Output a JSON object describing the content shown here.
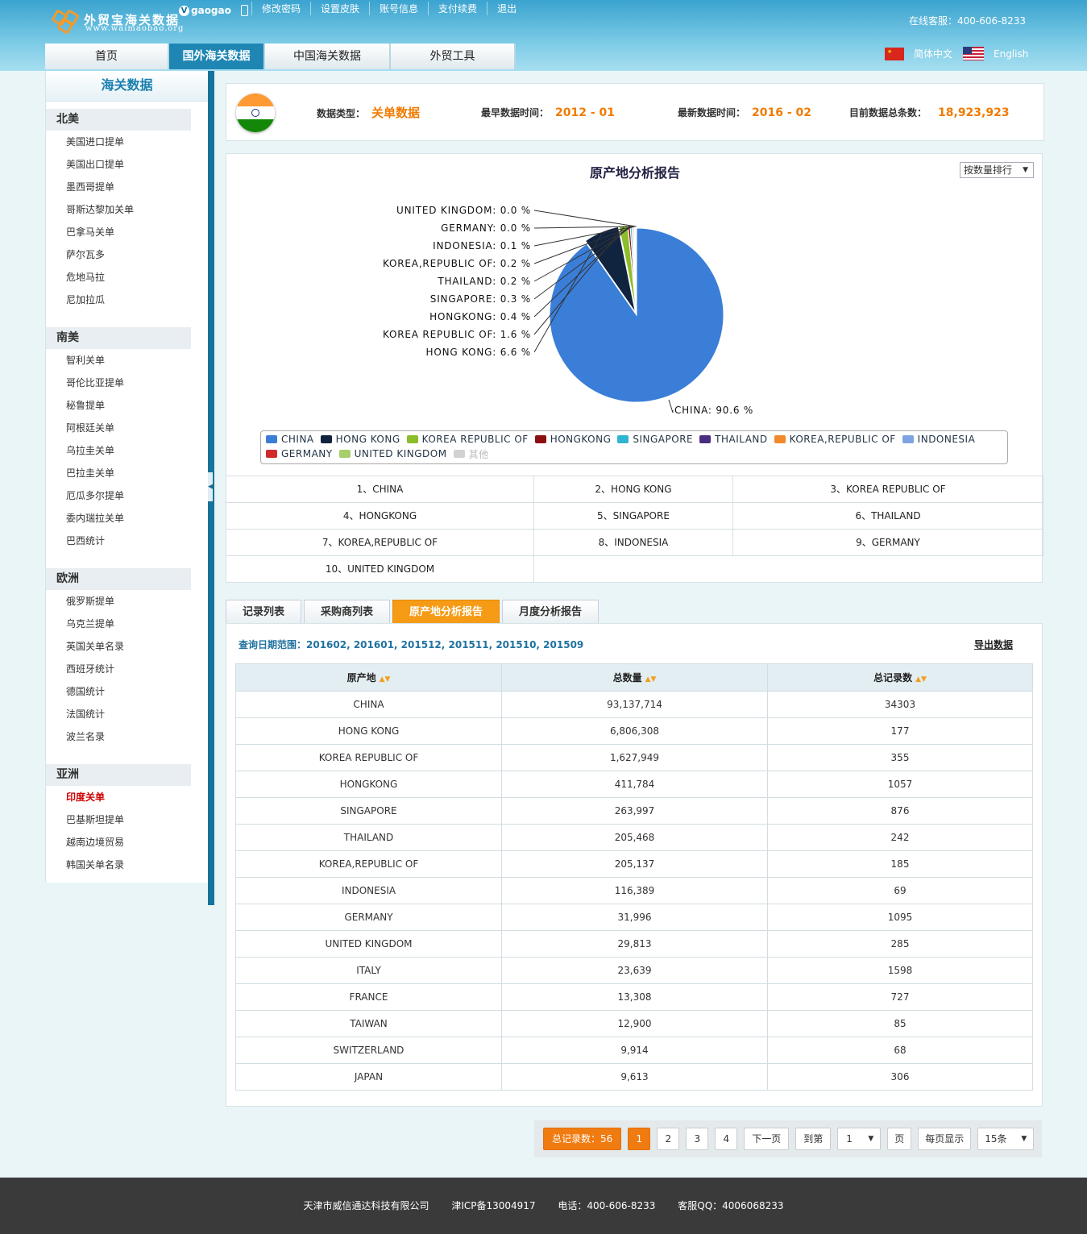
{
  "header": {
    "logo_title": "外贸宝海关数据",
    "logo_url": "www.waimaobao.org",
    "username": "gaogao",
    "links": [
      "修改密码",
      "设置皮肤",
      "账号信息",
      "支付续费",
      "退出"
    ],
    "service": "在线客服：400-606-8233",
    "nav": [
      "首页",
      "国外海关数据",
      "中国海关数据",
      "外贸工具"
    ],
    "lang_cn": "简体中文",
    "lang_en": "English"
  },
  "sidebar": {
    "title": "海关数据",
    "groups": [
      {
        "name": "北美",
        "items": [
          "美国进口提单",
          "美国出口提单",
          "墨西哥提单",
          "哥斯达黎加关单",
          "巴拿马关单",
          "萨尔瓦多",
          "危地马拉",
          "尼加拉瓜"
        ]
      },
      {
        "name": "南美",
        "items": [
          "智利关单",
          "哥伦比亚提单",
          "秘鲁提单",
          "阿根廷关单",
          "乌拉圭关单",
          "巴拉圭关单",
          "厄瓜多尔提单",
          "委内瑞拉关单",
          "巴西统计"
        ]
      },
      {
        "name": "欧洲",
        "items": [
          "俄罗斯提单",
          "乌克兰提单",
          "英国关单名录",
          "西班牙统计",
          "德国统计",
          "法国统计",
          "波兰名录"
        ]
      },
      {
        "name": "亚洲",
        "items": [
          "印度关单",
          "巴基斯坦提单",
          "越南边境贸易",
          "韩国关单名录"
        ]
      }
    ]
  },
  "info": {
    "type_label": "数据类型：",
    "type_value": "关单数据",
    "earliest_label": "最早数据时间：",
    "earliest_value": "2012 - 01",
    "latest_label": "最新数据时间：",
    "latest_value": "2016 - 02",
    "total_label": "目前数据总条数：",
    "total_value": "18,923,923"
  },
  "chart_data": {
    "type": "pie",
    "title": "原产地分析报告",
    "sort_select": "按数量排行",
    "slices": [
      {
        "label": "CHINA",
        "value": 90.6,
        "color": "#3a7ed8"
      },
      {
        "label": "HONG KONG",
        "value": 6.6,
        "color": "#10233f"
      },
      {
        "label": "KOREA REPUBLIC OF",
        "value": 1.6,
        "color": "#8cbd2a"
      },
      {
        "label": "HONGKONG",
        "value": 0.4,
        "color": "#8b0f12"
      },
      {
        "label": "SINGAPORE",
        "value": 0.3,
        "color": "#2fb5cf"
      },
      {
        "label": "THAILAND",
        "value": 0.2,
        "color": "#4a2d80"
      },
      {
        "label": "KOREA,REPUBLIC OF",
        "value": 0.2,
        "color": "#f08a2a"
      },
      {
        "label": "INDONESIA",
        "value": 0.1,
        "color": "#7ea3e3"
      },
      {
        "label": "GERMANY",
        "value": 0.0,
        "color": "#d12a2a"
      },
      {
        "label": "UNITED KINGDOM",
        "value": 0.0,
        "color": "#a6d06a"
      }
    ],
    "other_label": "其他",
    "other_color": "#d2d2d2"
  },
  "ranking": [
    "1、CHINA",
    "2、HONG KONG",
    "3、KOREA REPUBLIC OF",
    "4、HONGKONG",
    "5、SINGAPORE",
    "6、THAILAND",
    "7、KOREA,REPUBLIC OF",
    "8、INDONESIA",
    "9、GERMANY",
    "10、UNITED KINGDOM"
  ],
  "tabs": [
    "记录列表",
    "采购商列表",
    "原产地分析报告",
    "月度分析报告"
  ],
  "table": {
    "range": "查询日期范围：201602, 201601, 201512, 201511, 201510, 201509",
    "export": "导出数据",
    "headers": [
      "原产地",
      "总数量",
      "总记录数"
    ],
    "rows": [
      [
        "CHINA",
        "93,137,714",
        "34303"
      ],
      [
        "HONG KONG",
        "6,806,308",
        "177"
      ],
      [
        "KOREA REPUBLIC OF",
        "1,627,949",
        "355"
      ],
      [
        "HONGKONG",
        "411,784",
        "1057"
      ],
      [
        "SINGAPORE",
        "263,997",
        "876"
      ],
      [
        "THAILAND",
        "205,468",
        "242"
      ],
      [
        "KOREA,REPUBLIC OF",
        "205,137",
        "185"
      ],
      [
        "INDONESIA",
        "116,389",
        "69"
      ],
      [
        "GERMANY",
        "31,996",
        "1095"
      ],
      [
        "UNITED KINGDOM",
        "29,813",
        "285"
      ],
      [
        "ITALY",
        "23,639",
        "1598"
      ],
      [
        "FRANCE",
        "13,308",
        "727"
      ],
      [
        "TAIWAN",
        "12,900",
        "85"
      ],
      [
        "SWITZERLAND",
        "9,914",
        "68"
      ],
      [
        "JAPAN",
        "9,613",
        "306"
      ]
    ]
  },
  "pager": {
    "total": "总记录数：56",
    "pages": [
      "1",
      "2",
      "3",
      "4"
    ],
    "next": "下一页",
    "goto": "到第",
    "page_select": "1",
    "page_unit": "页",
    "per_page_label": "每页显示",
    "per_page_select": "15条"
  },
  "footer": {
    "company": "天津市威信通达科技有限公司",
    "icp": "津ICP备13004917",
    "phone": "电话：400-606-8233",
    "qq": "客服QQ：4006068233"
  }
}
